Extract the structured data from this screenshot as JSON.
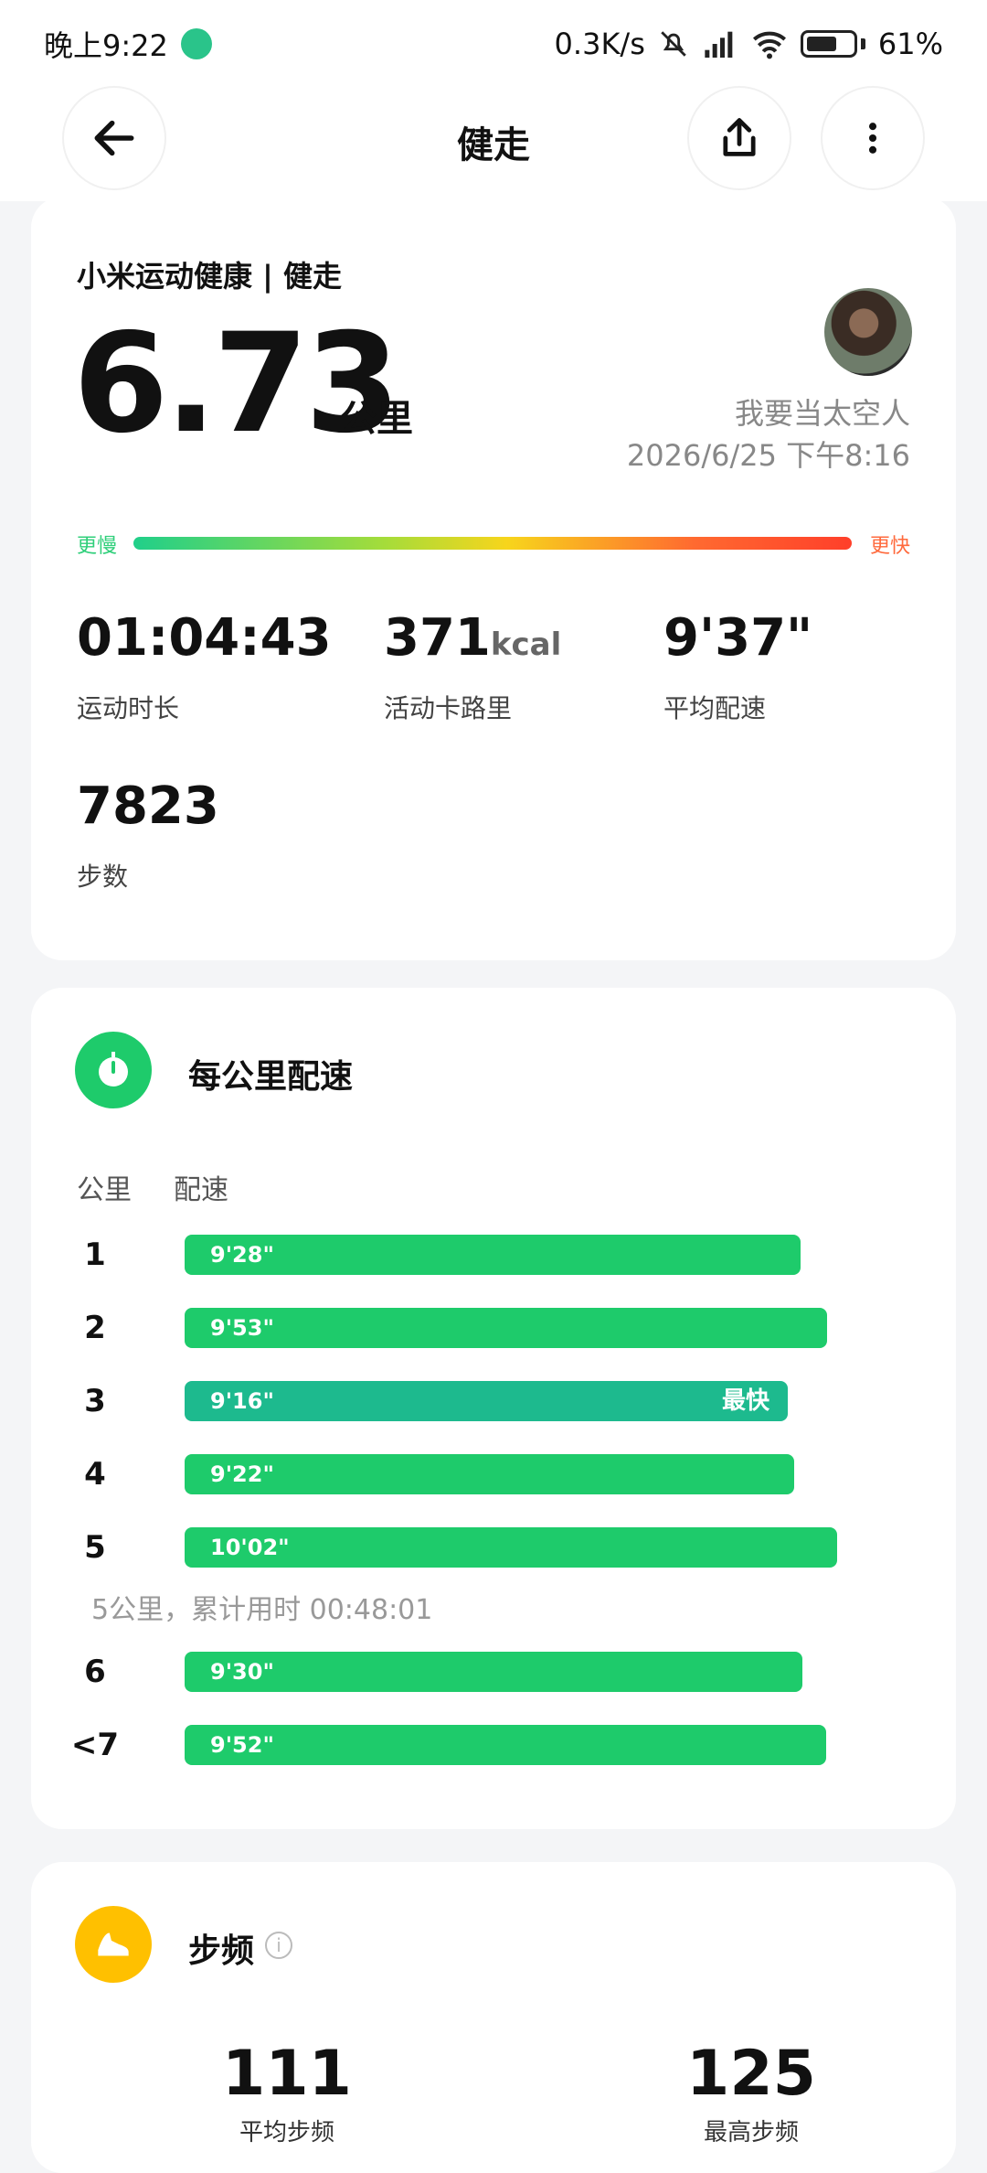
{
  "status_bar": {
    "time": "晚上9:22",
    "network_speed": "0.3K/s",
    "battery": "61%"
  },
  "header": {
    "title": "健走",
    "back_icon": "arrow-left-icon",
    "share_icon": "share-icon",
    "more_icon": "more-vertical-icon"
  },
  "summary": {
    "source_title": "小米运动健康 | 健走",
    "distance": "6.73",
    "distance_unit": "公里",
    "user_name": "我要当太空人",
    "datetime": "2026/6/25 下午8:16",
    "slow_label": "更慢",
    "fast_label": "更快",
    "duration": "01:04:43",
    "duration_label": "运动时长",
    "calories": "371",
    "calories_unit": "kcal",
    "calories_label": "活动卡路里",
    "avg_pace": "9'37\"",
    "avg_pace_label": "平均配速",
    "steps": "7823",
    "steps_label": "步数"
  },
  "pace_section": {
    "title": "每公里配速",
    "col_km": "公里",
    "col_pace": "配速",
    "fastest_tag": "最快",
    "cumulative_note": "5公里，累计用时 00:48:01",
    "rows": [
      {
        "km": "1",
        "pace": "9'28\"",
        "seconds": 568,
        "fastest": false
      },
      {
        "km": "2",
        "pace": "9'53\"",
        "seconds": 593,
        "fastest": false
      },
      {
        "km": "3",
        "pace": "9'16\"",
        "seconds": 556,
        "fastest": true
      },
      {
        "km": "4",
        "pace": "9'22\"",
        "seconds": 562,
        "fastest": false
      },
      {
        "km": "5",
        "pace": "10'02\"",
        "seconds": 602,
        "fastest": false
      },
      {
        "km": "6",
        "pace": "9'30\"",
        "seconds": 570,
        "fastest": false
      },
      {
        "km": "<7",
        "pace": "9'52\"",
        "seconds": 592,
        "fastest": false
      }
    ]
  },
  "cadence_section": {
    "title": "步频",
    "avg_value": "111",
    "avg_label": "平均步频",
    "max_value": "125",
    "max_label": "最高步频"
  },
  "colors": {
    "green": "#1ecb6b",
    "fastest_green": "#1dba8e",
    "cadence_yellow": "#ffc000"
  }
}
